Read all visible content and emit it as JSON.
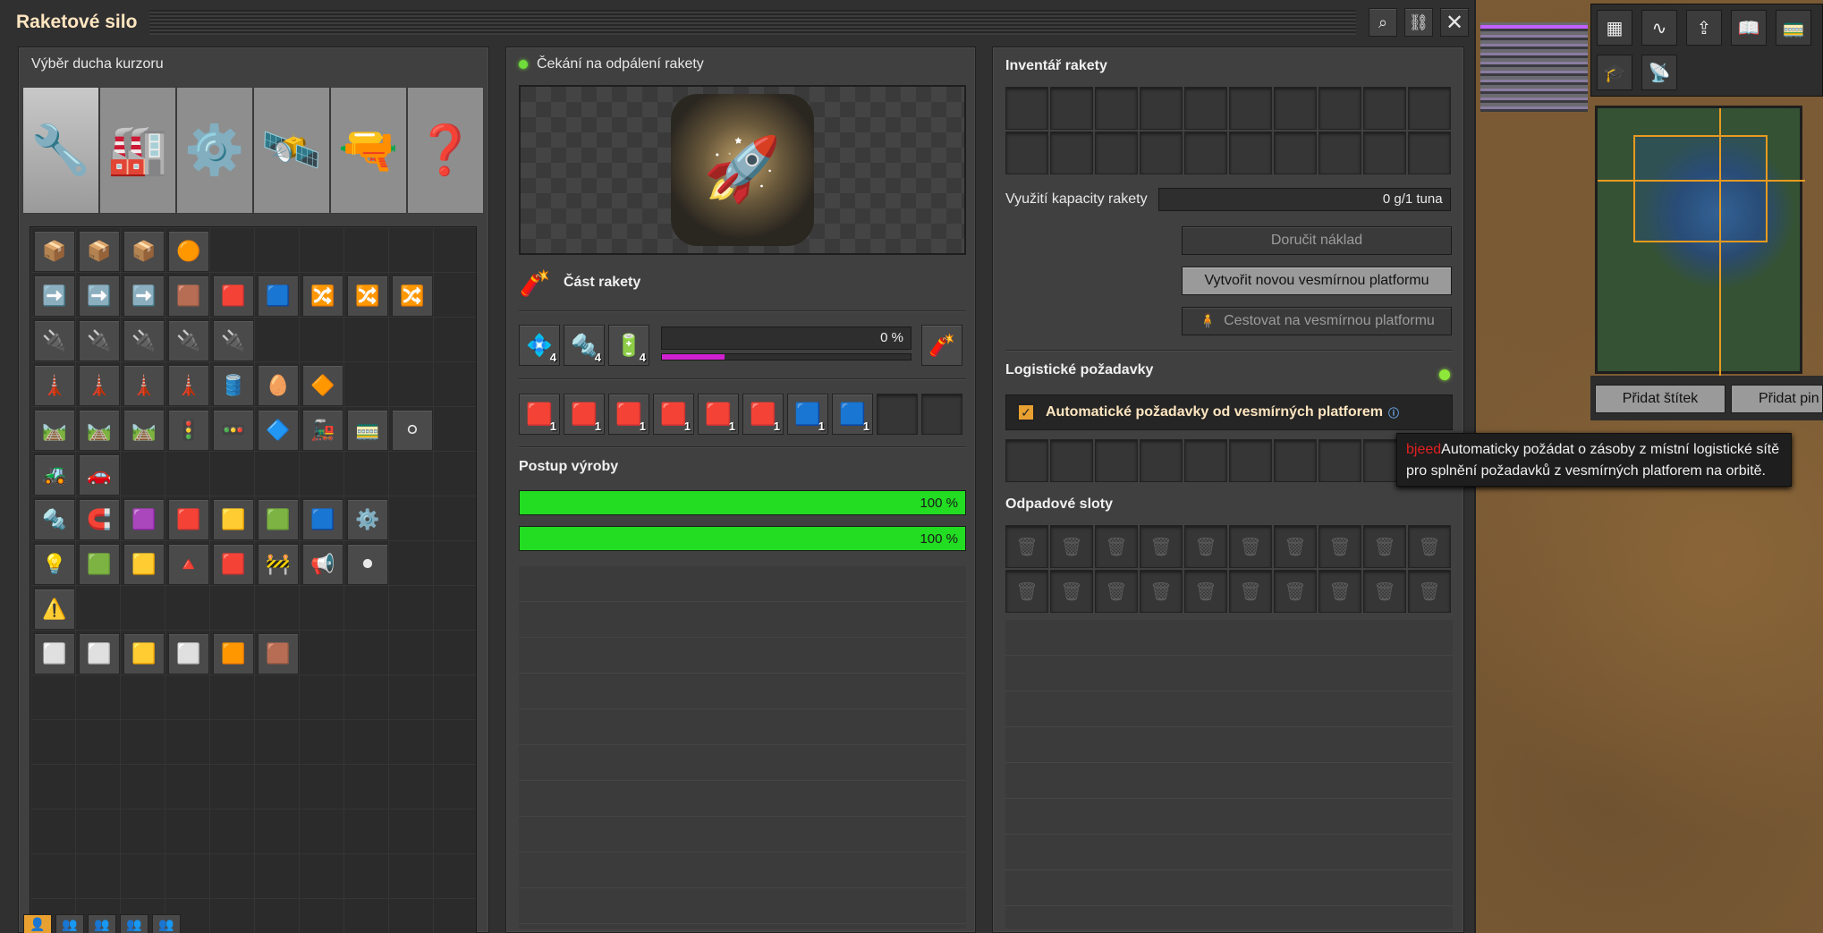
{
  "window": {
    "title": "Raketové silo"
  },
  "left": {
    "title": "Výběr ducha kurzoru",
    "group_icons": [
      "🔧",
      "🏭",
      "⚙️",
      "🛰️",
      "🔫",
      "❓"
    ],
    "rows": [
      [
        "📦",
        "📦",
        "📦",
        "🟠"
      ],
      [
        "➡️",
        "➡️",
        "➡️",
        "🟫",
        "🟥",
        "🟦",
        "🔀",
        "🔀",
        "🔀"
      ],
      [
        "🔌",
        "🔌",
        "🔌",
        "🔌",
        "🔌"
      ],
      [
        "🗼",
        "🗼",
        "🗼",
        "🗼",
        "🛢️",
        "🥚",
        "🔶"
      ],
      [
        "🛤️",
        "🛤️",
        "🛤️",
        "🚦",
        "🚥",
        "🔷",
        "🚂",
        "🚃",
        "⚪"
      ],
      [
        "🚜",
        "🚗"
      ],
      [
        "🔩",
        "🧲",
        "🟪",
        "🟥",
        "🟨",
        "🟩",
        "🟦",
        "⚙️"
      ],
      [
        "💡",
        "🟩",
        "🟨",
        "🔺",
        "🟥",
        "🚧",
        "📢",
        "⚫"
      ],
      [
        "⚠️"
      ],
      [
        "⬜",
        "⬜",
        "🟨",
        "⬜",
        "🟧",
        "🟫"
      ]
    ],
    "bottom_tabs": [
      "👤",
      "👥",
      "👥",
      "👥",
      "👥"
    ]
  },
  "middle": {
    "status": "Čekání na odpálení rakety",
    "silo_icon": "🚀",
    "recipe": {
      "icon": "🧨",
      "name": "Část rakety"
    },
    "ingredients": [
      {
        "icon": "💠",
        "count": "4"
      },
      {
        "icon": "🔩",
        "count": "4"
      },
      {
        "icon": "🔋",
        "count": "4"
      }
    ],
    "craft_progress_text": "0 %",
    "productivity_fraction": 0.25,
    "output_icon": "🧨",
    "modules": [
      {
        "icon": "🟥",
        "count": "1"
      },
      {
        "icon": "🟥",
        "count": "1"
      },
      {
        "icon": "🟥",
        "count": "1"
      },
      {
        "icon": "🟥",
        "count": "1"
      },
      {
        "icon": "🟥",
        "count": "1"
      },
      {
        "icon": "🟥",
        "count": "1"
      },
      {
        "icon": "🟦",
        "count": "1"
      },
      {
        "icon": "🟦",
        "count": "1"
      }
    ],
    "production_title": "Postup výroby",
    "bars": [
      {
        "text": "100 %",
        "fraction": 1.0
      },
      {
        "text": "100 %",
        "fraction": 1.0
      }
    ]
  },
  "right": {
    "inventory_title": "Inventář rakety",
    "capacity_label": "Využití kapacity rakety",
    "capacity_value": "0 g/1 tuna",
    "deliver_button": "Doručit náklad",
    "create_platform_button": "Vytvořit novou vesmírnou platformu",
    "travel_button": "Cestovat na vesmírnou platformu",
    "logistic_title": "Logistické požadavky",
    "auto_requests_label": "Automatické požadavky od vesmírných platforem",
    "trash_title": "Odpadové sloty",
    "trash_icon": "🗑"
  },
  "tooltip": {
    "tag": "bjeed",
    "text": "Automaticky požádat o zásoby z místní logistické sítě",
    "text2": "pro splnění požadavků z vesmírných platforem na orbitě."
  },
  "map": {
    "add_tag_button": "Přidat štítek",
    "add_pin_button": "Přidat pin"
  },
  "colors": {
    "progress_green": "#22dd22",
    "productivity_magenta": "#d020d0",
    "title_text": "#ffe6c0",
    "checkbox_orange": "#e8a030"
  }
}
